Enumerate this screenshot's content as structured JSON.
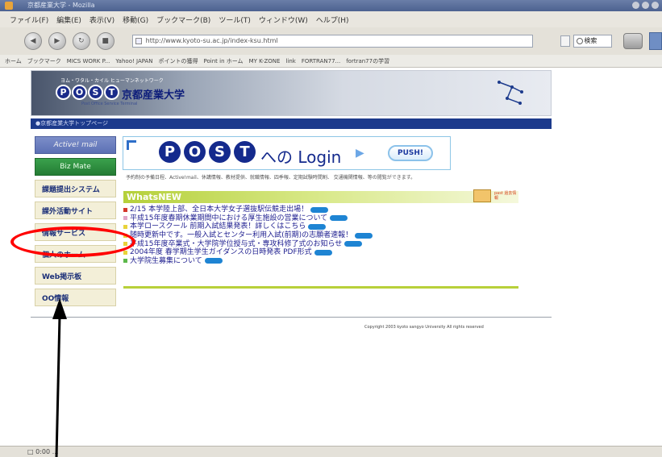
{
  "window": {
    "title": "京都産業大学 - Mozilla"
  },
  "menubar": {
    "items": [
      "ファイル(F)",
      "編集(E)",
      "表示(V)",
      "移動(G)",
      "ブックマーク(B)",
      "ツール(T)",
      "ウィンドウ(W)",
      "ヘルプ(H)"
    ]
  },
  "navbar": {
    "url": "http://www.kyoto-su.ac.jp/index-ksu.html",
    "search_label": "検索"
  },
  "bookmarks": {
    "items": [
      "ホーム",
      "ブックマーク",
      "MICS WORK P...",
      "Yahoo! JAPAN",
      "ポイントの獲得",
      "Point in ホーム",
      "MY K-ZONE",
      "link",
      "FORTRAN77...",
      "fortran77の学習"
    ]
  },
  "banner": {
    "tagline": "ヨム・ワタル・カイル ヒューマンネットワーク",
    "post_letters": [
      "P",
      "O",
      "S",
      "T"
    ],
    "university_name": "京都産業大学",
    "subtitle": "Post Office Service Terminal"
  },
  "breadcrumb": {
    "text": "●京都産業大学トップページ"
  },
  "sidebar": {
    "items": [
      {
        "label": "Active! mail"
      },
      {
        "label": "Biz Mate"
      },
      {
        "label": "課題提出システム"
      },
      {
        "label": "課外活動サイト"
      },
      {
        "label": "情報サービス"
      },
      {
        "label": "個人のホーム"
      },
      {
        "label": "Web掲示板"
      },
      {
        "label": "OO情報"
      }
    ]
  },
  "login_banner": {
    "letters": [
      "P",
      "O",
      "S",
      "T"
    ],
    "text": "への Login",
    "arrow": "▶",
    "push_label": "PUSH!"
  },
  "intro": {
    "text": "予約制の予備日程、Active!mail、休講情報、教材提供、就職情報、四季報、定期試験時間割、 交通機関情報、等の閲覧ができます。"
  },
  "news": {
    "header": "WhatsNEW",
    "past_news_label": "past 過去情報",
    "items": [
      "2/15 本学陸上部、全日本大学女子選抜駅伝競走出場！",
      "平成15年度春期休業期間中における厚生施設の営業について",
      "本学ロースクール 前期入試結果発表！詳しくはこちら",
      "随時更新中です。一般入試とセンター利用入試(前期)の志願者速報！",
      "平成15年度卒業式・大学院学位授与式・専攻科修了式のお知らせ",
      "2004年度 春学期生学生ガイダンスの日時発表 PDF形式",
      "大学院生募集について"
    ],
    "bullet_colors": [
      "#d4372b",
      "#e0a6c8",
      "#e8d33a",
      "#e8d33a",
      "#e8d33a",
      "#e8d33a",
      "#5cb84a"
    ]
  },
  "footer": {
    "copyright": "Copyright 2003 kyoto sangyo University All rights reserved"
  },
  "statusbar": {
    "text": "□ 0:00 …"
  },
  "colors": {
    "annotation_circle": "#ff0000",
    "annotation_arrow": "#000000",
    "breadcrumb_bg": "#1c3a8c",
    "news_accent": "#b5d03a"
  }
}
